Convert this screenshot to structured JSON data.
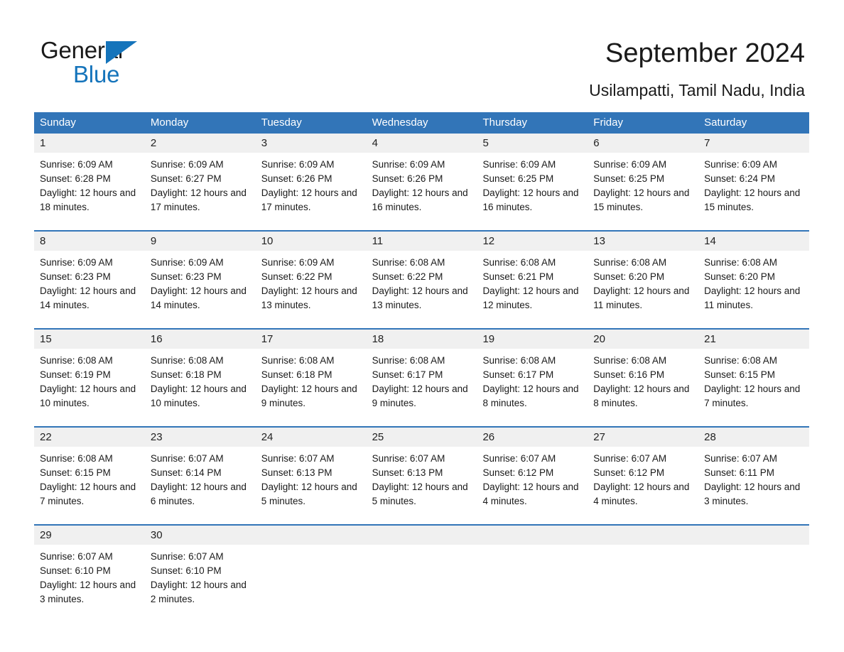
{
  "logo": {
    "text_primary": "General",
    "text_secondary": "Blue",
    "triangle_icon": "triangle-icon",
    "color_primary": "#1a1a1a",
    "color_secondary": "#1574bb"
  },
  "header": {
    "title": "September 2024",
    "subtitle": "Usilampatti, Tamil Nadu, India"
  },
  "theme": {
    "header_blue": "#3275b8",
    "date_band_gray": "#f0f0f0",
    "text_dark": "#1a1a1a"
  },
  "weekdays": [
    "Sunday",
    "Monday",
    "Tuesday",
    "Wednesday",
    "Thursday",
    "Friday",
    "Saturday"
  ],
  "weeks": [
    {
      "days": [
        {
          "date": "1",
          "sunrise": "Sunrise: 6:09 AM",
          "sunset": "Sunset: 6:28 PM",
          "daylight": "Daylight: 12 hours and 18 minutes."
        },
        {
          "date": "2",
          "sunrise": "Sunrise: 6:09 AM",
          "sunset": "Sunset: 6:27 PM",
          "daylight": "Daylight: 12 hours and 17 minutes."
        },
        {
          "date": "3",
          "sunrise": "Sunrise: 6:09 AM",
          "sunset": "Sunset: 6:26 PM",
          "daylight": "Daylight: 12 hours and 17 minutes."
        },
        {
          "date": "4",
          "sunrise": "Sunrise: 6:09 AM",
          "sunset": "Sunset: 6:26 PM",
          "daylight": "Daylight: 12 hours and 16 minutes."
        },
        {
          "date": "5",
          "sunrise": "Sunrise: 6:09 AM",
          "sunset": "Sunset: 6:25 PM",
          "daylight": "Daylight: 12 hours and 16 minutes."
        },
        {
          "date": "6",
          "sunrise": "Sunrise: 6:09 AM",
          "sunset": "Sunset: 6:25 PM",
          "daylight": "Daylight: 12 hours and 15 minutes."
        },
        {
          "date": "7",
          "sunrise": "Sunrise: 6:09 AM",
          "sunset": "Sunset: 6:24 PM",
          "daylight": "Daylight: 12 hours and 15 minutes."
        }
      ]
    },
    {
      "days": [
        {
          "date": "8",
          "sunrise": "Sunrise: 6:09 AM",
          "sunset": "Sunset: 6:23 PM",
          "daylight": "Daylight: 12 hours and 14 minutes."
        },
        {
          "date": "9",
          "sunrise": "Sunrise: 6:09 AM",
          "sunset": "Sunset: 6:23 PM",
          "daylight": "Daylight: 12 hours and 14 minutes."
        },
        {
          "date": "10",
          "sunrise": "Sunrise: 6:09 AM",
          "sunset": "Sunset: 6:22 PM",
          "daylight": "Daylight: 12 hours and 13 minutes."
        },
        {
          "date": "11",
          "sunrise": "Sunrise: 6:08 AM",
          "sunset": "Sunset: 6:22 PM",
          "daylight": "Daylight: 12 hours and 13 minutes."
        },
        {
          "date": "12",
          "sunrise": "Sunrise: 6:08 AM",
          "sunset": "Sunset: 6:21 PM",
          "daylight": "Daylight: 12 hours and 12 minutes."
        },
        {
          "date": "13",
          "sunrise": "Sunrise: 6:08 AM",
          "sunset": "Sunset: 6:20 PM",
          "daylight": "Daylight: 12 hours and 11 minutes."
        },
        {
          "date": "14",
          "sunrise": "Sunrise: 6:08 AM",
          "sunset": "Sunset: 6:20 PM",
          "daylight": "Daylight: 12 hours and 11 minutes."
        }
      ]
    },
    {
      "days": [
        {
          "date": "15",
          "sunrise": "Sunrise: 6:08 AM",
          "sunset": "Sunset: 6:19 PM",
          "daylight": "Daylight: 12 hours and 10 minutes."
        },
        {
          "date": "16",
          "sunrise": "Sunrise: 6:08 AM",
          "sunset": "Sunset: 6:18 PM",
          "daylight": "Daylight: 12 hours and 10 minutes."
        },
        {
          "date": "17",
          "sunrise": "Sunrise: 6:08 AM",
          "sunset": "Sunset: 6:18 PM",
          "daylight": "Daylight: 12 hours and 9 minutes."
        },
        {
          "date": "18",
          "sunrise": "Sunrise: 6:08 AM",
          "sunset": "Sunset: 6:17 PM",
          "daylight": "Daylight: 12 hours and 9 minutes."
        },
        {
          "date": "19",
          "sunrise": "Sunrise: 6:08 AM",
          "sunset": "Sunset: 6:17 PM",
          "daylight": "Daylight: 12 hours and 8 minutes."
        },
        {
          "date": "20",
          "sunrise": "Sunrise: 6:08 AM",
          "sunset": "Sunset: 6:16 PM",
          "daylight": "Daylight: 12 hours and 8 minutes."
        },
        {
          "date": "21",
          "sunrise": "Sunrise: 6:08 AM",
          "sunset": "Sunset: 6:15 PM",
          "daylight": "Daylight: 12 hours and 7 minutes."
        }
      ]
    },
    {
      "days": [
        {
          "date": "22",
          "sunrise": "Sunrise: 6:08 AM",
          "sunset": "Sunset: 6:15 PM",
          "daylight": "Daylight: 12 hours and 7 minutes."
        },
        {
          "date": "23",
          "sunrise": "Sunrise: 6:07 AM",
          "sunset": "Sunset: 6:14 PM",
          "daylight": "Daylight: 12 hours and 6 minutes."
        },
        {
          "date": "24",
          "sunrise": "Sunrise: 6:07 AM",
          "sunset": "Sunset: 6:13 PM",
          "daylight": "Daylight: 12 hours and 5 minutes."
        },
        {
          "date": "25",
          "sunrise": "Sunrise: 6:07 AM",
          "sunset": "Sunset: 6:13 PM",
          "daylight": "Daylight: 12 hours and 5 minutes."
        },
        {
          "date": "26",
          "sunrise": "Sunrise: 6:07 AM",
          "sunset": "Sunset: 6:12 PM",
          "daylight": "Daylight: 12 hours and 4 minutes."
        },
        {
          "date": "27",
          "sunrise": "Sunrise: 6:07 AM",
          "sunset": "Sunset: 6:12 PM",
          "daylight": "Daylight: 12 hours and 4 minutes."
        },
        {
          "date": "28",
          "sunrise": "Sunrise: 6:07 AM",
          "sunset": "Sunset: 6:11 PM",
          "daylight": "Daylight: 12 hours and 3 minutes."
        }
      ]
    },
    {
      "days": [
        {
          "date": "29",
          "sunrise": "Sunrise: 6:07 AM",
          "sunset": "Sunset: 6:10 PM",
          "daylight": "Daylight: 12 hours and 3 minutes."
        },
        {
          "date": "30",
          "sunrise": "Sunrise: 6:07 AM",
          "sunset": "Sunset: 6:10 PM",
          "daylight": "Daylight: 12 hours and 2 minutes."
        },
        {
          "date": "",
          "sunrise": "",
          "sunset": "",
          "daylight": ""
        },
        {
          "date": "",
          "sunrise": "",
          "sunset": "",
          "daylight": ""
        },
        {
          "date": "",
          "sunrise": "",
          "sunset": "",
          "daylight": ""
        },
        {
          "date": "",
          "sunrise": "",
          "sunset": "",
          "daylight": ""
        },
        {
          "date": "",
          "sunrise": "",
          "sunset": "",
          "daylight": ""
        }
      ]
    }
  ]
}
